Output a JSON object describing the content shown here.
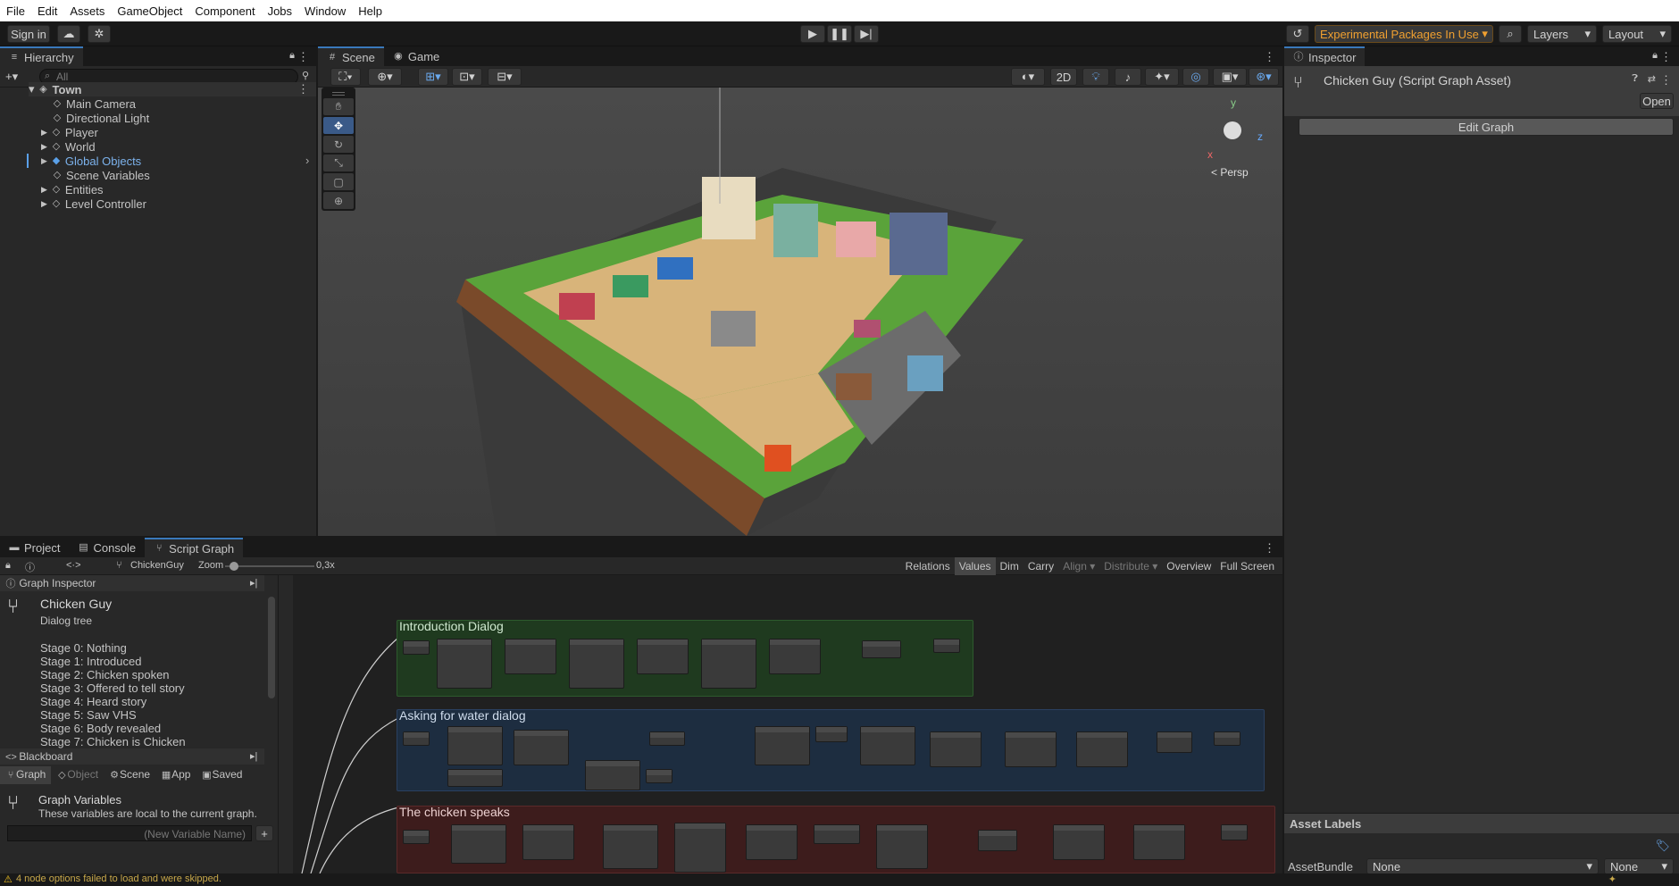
{
  "menu": [
    "File",
    "Edit",
    "Assets",
    "GameObject",
    "Component",
    "Jobs",
    "Window",
    "Help"
  ],
  "toolbar": {
    "sign_in": "Sign in",
    "experimental": "Experimental Packages In Use",
    "layers": "Layers",
    "layout": "Layout"
  },
  "hierarchy": {
    "tab": "Hierarchy",
    "search_placeholder": "All",
    "scene_name": "Town",
    "items": [
      {
        "label": "Main Camera"
      },
      {
        "label": "Directional Light"
      },
      {
        "label": "Player"
      },
      {
        "label": "World"
      },
      {
        "label": "Global Objects"
      },
      {
        "label": "Scene Variables"
      },
      {
        "label": "Entities"
      },
      {
        "label": "Level Controller"
      }
    ]
  },
  "scene": {
    "tabs": [
      "Scene",
      "Game"
    ],
    "mode_2d": "2D",
    "persp": "Persp",
    "gizmo_y": "y",
    "gizmo_z": "z",
    "gizmo_x": "x"
  },
  "inspector": {
    "tab": "Inspector",
    "title": "Chicken Guy (Script Graph Asset)",
    "open": "Open",
    "edit_graph": "Edit Graph",
    "asset_labels": "Asset Labels",
    "asset_bundle": "AssetBundle",
    "bundle_value": "None",
    "variant_value": "None"
  },
  "bottom": {
    "tabs": [
      "Project",
      "Console",
      "Script Graph"
    ],
    "breadcrumb": "ChickenGuy",
    "zoom_label": "Zoom",
    "zoom_value": "0,3x",
    "zoom_level": 0.05,
    "right_tools": [
      "Relations",
      "Values",
      "Dim",
      "Carry",
      "Align",
      "Distribute",
      "Overview",
      "Full Screen"
    ]
  },
  "graph_inspector": {
    "header": "Graph Inspector",
    "title": "Chicken Guy",
    "subtitle": "Dialog tree",
    "stages": [
      "Stage 0: Nothing",
      "Stage 1: Introduced",
      "Stage 2: Chicken spoken",
      "Stage 3: Offered to tell story",
      "Stage 4: Heard story",
      "Stage 5: Saw VHS",
      "Stage 6: Body revealed",
      "Stage 7: Chicken is Chicken"
    ]
  },
  "blackboard": {
    "header": "Blackboard",
    "tabs": [
      "Graph",
      "Object",
      "Scene",
      "App",
      "Saved"
    ],
    "section_title": "Graph Variables",
    "section_desc": "These variables are local to the current graph.",
    "new_var_placeholder": "(New Variable Name)"
  },
  "graph": {
    "groups": [
      {
        "title": "Introduction Dialog",
        "color": "#1f3a1f"
      },
      {
        "title": "Asking for water dialog",
        "color": "#1d2d40"
      },
      {
        "title": "The chicken speaks",
        "color": "#3d1c1c"
      }
    ]
  },
  "status": {
    "warning": "4 node options failed to load and were skipped."
  }
}
